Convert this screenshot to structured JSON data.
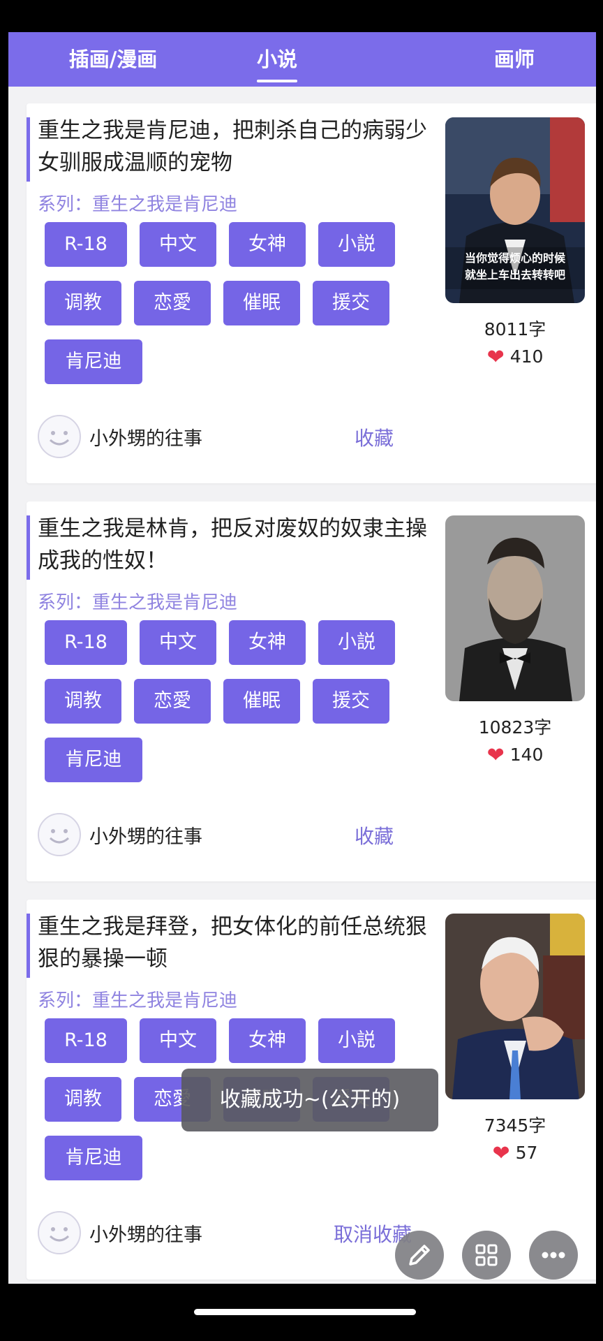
{
  "tabs": [
    {
      "label": "插画/漫画",
      "active": false
    },
    {
      "label": "小说",
      "active": true
    },
    {
      "label": "画师",
      "active": false
    }
  ],
  "cards": [
    {
      "title": "重生之我是肯尼迪，把刺杀自己的病弱少女驯服成温顺的宠物",
      "series": "系列：重生之我是肯尼迪",
      "tags": [
        "R-18",
        "中文",
        "女神",
        "小説",
        "调教",
        "恋愛",
        "催眠",
        "援交",
        "肯尼迪"
      ],
      "thumb_caption": "当你觉得烦心的时候\n就坐上车出去转转吧",
      "word_count": "8011字",
      "likes": "410",
      "author": "小外甥的往事",
      "fav_label": "收藏"
    },
    {
      "title": "重生之我是林肯，把反对废奴的奴隶主操成我的性奴！",
      "series": "系列：重生之我是肯尼迪",
      "tags": [
        "R-18",
        "中文",
        "女神",
        "小説",
        "调教",
        "恋愛",
        "催眠",
        "援交",
        "肯尼迪"
      ],
      "word_count": "10823字",
      "likes": "140",
      "author": "小外甥的往事",
      "fav_label": "收藏"
    },
    {
      "title": "重生之我是拜登，把女体化的前任总统狠狠的暴操一顿",
      "series": "系列：重生之我是肯尼迪",
      "tags": [
        "R-18",
        "中文",
        "女神",
        "小説",
        "调教",
        "恋愛",
        "催眠",
        "援交",
        "肯尼迪"
      ],
      "word_count": "7345字",
      "likes": "57",
      "author": "小外甥的往事",
      "fav_label": "取消收藏"
    }
  ],
  "toast": "收藏成功~(公开的)",
  "fabs": [
    "edit-icon",
    "grid-icon",
    "more-icon"
  ],
  "colors": {
    "accent": "#7b6cea",
    "tag": "#7565e6",
    "heart": "#e8344c"
  }
}
